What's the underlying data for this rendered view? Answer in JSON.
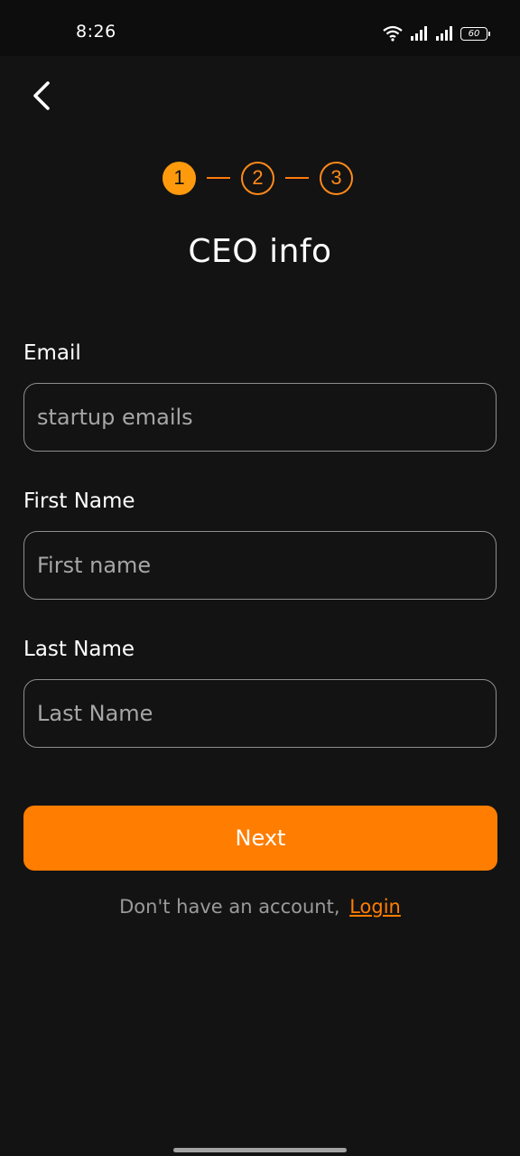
{
  "status_bar": {
    "time": "8:26",
    "battery_level": "60",
    "icons": [
      "wifi-icon",
      "signal-icon",
      "signal-icon",
      "battery-icon"
    ]
  },
  "header": {
    "back_icon": "chevron-left-icon"
  },
  "stepper": {
    "steps": [
      "1",
      "2",
      "3"
    ],
    "active_step": 1,
    "accent_color": "#ff9a0c"
  },
  "title": "CEO info",
  "form": {
    "email": {
      "label": "Email",
      "placeholder": "startup emails",
      "value": ""
    },
    "first_name": {
      "label": "First Name",
      "placeholder": "First name",
      "value": ""
    },
    "last_name": {
      "label": "Last Name",
      "placeholder": "Last Name",
      "value": ""
    }
  },
  "next_button_label": "Next",
  "footer": {
    "prompt": "Don't have an account,",
    "login_label": "Login"
  },
  "colors": {
    "background": "#131313",
    "primary": "#ff7d00",
    "text": "#ffffff",
    "muted": "#9a9a9a"
  }
}
